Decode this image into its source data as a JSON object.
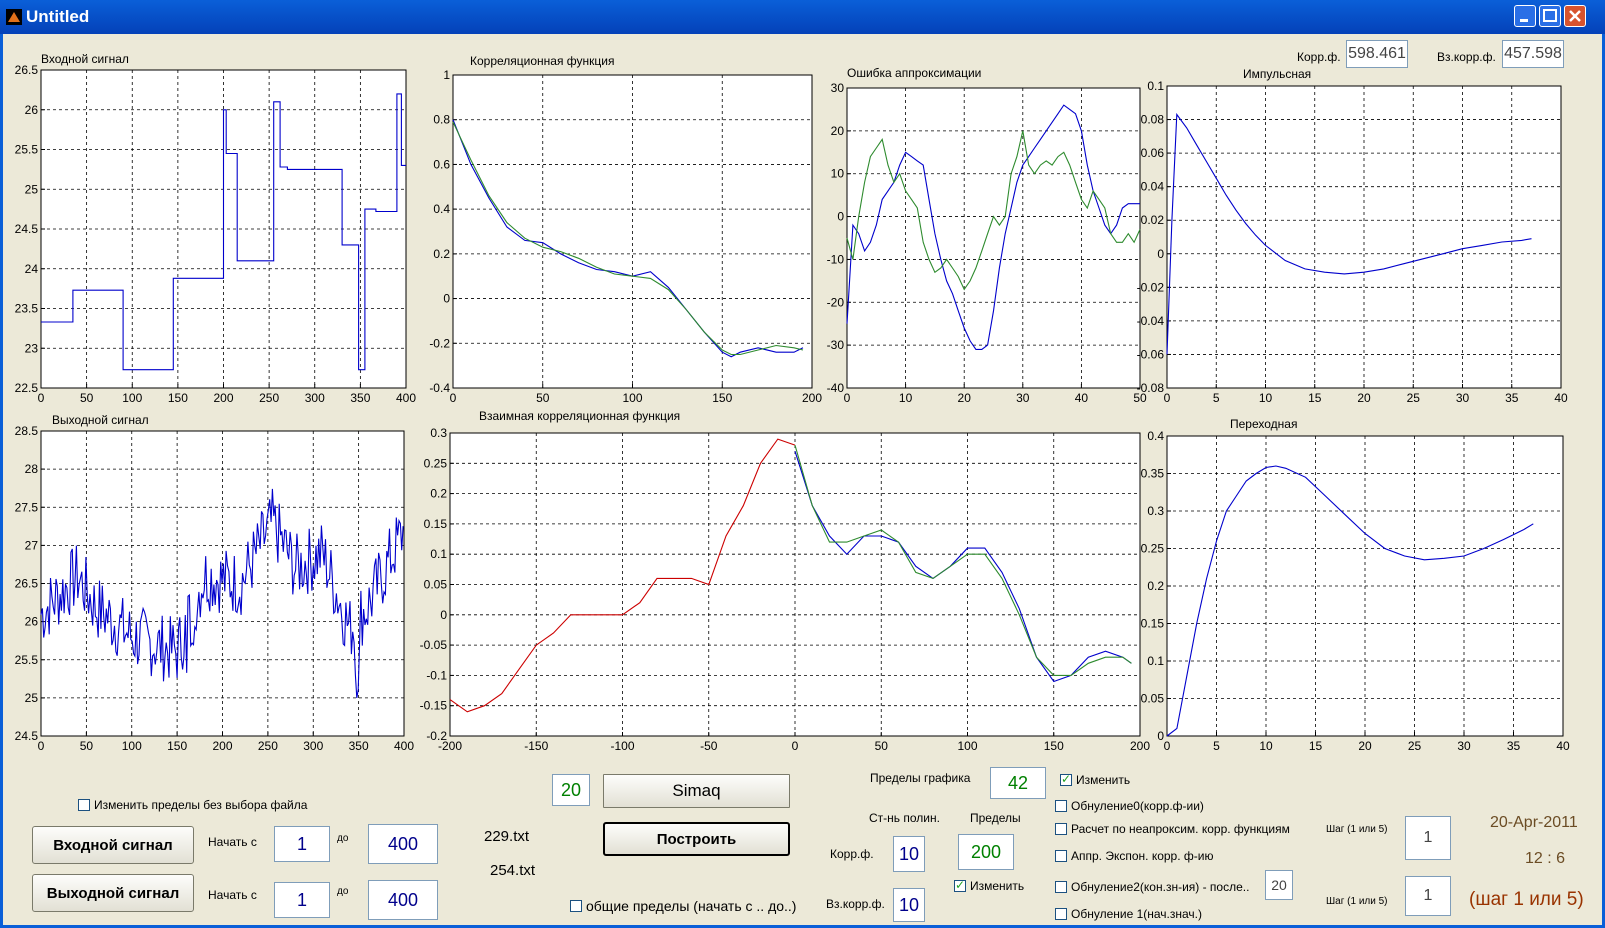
{
  "window": {
    "title": "Untitled"
  },
  "plots": [
    {
      "id": "input",
      "title": "Входной сигнал",
      "x_ticks": [
        "0",
        "50",
        "100",
        "150",
        "200",
        "250",
        "300",
        "350",
        "400"
      ],
      "y_ticks": [
        "22.5",
        "23",
        "23.5",
        "24",
        "24.5",
        "25",
        "25.5",
        "26",
        "26.5"
      ],
      "xlim": [
        0,
        400
      ],
      "ylim": [
        22.5,
        26.5
      ]
    },
    {
      "id": "corr",
      "title": "Корреляционная функция",
      "x_ticks": [
        "0",
        "50",
        "100",
        "150",
        "200"
      ],
      "y_ticks": [
        "-0.4",
        "-0.2",
        "0",
        "0.2",
        "0.4",
        "0.6",
        "0.8",
        "1"
      ],
      "xlim": [
        0,
        200
      ],
      "ylim": [
        -0.4,
        1
      ]
    },
    {
      "id": "err",
      "title": "Ошибка аппроксимации",
      "x_ticks": [
        "0",
        "10",
        "20",
        "30",
        "40",
        "50"
      ],
      "y_ticks": [
        "-40",
        "-30",
        "-20",
        "-10",
        "0",
        "10",
        "20",
        "30"
      ],
      "xlim": [
        0,
        50
      ],
      "ylim": [
        -40,
        30
      ]
    },
    {
      "id": "imp",
      "title": "Импульсная",
      "x_ticks": [
        "0",
        "5",
        "10",
        "15",
        "20",
        "25",
        "30",
        "35",
        "40"
      ],
      "y_ticks": [
        "-0.08",
        "-0.06",
        "-0.04",
        "-0.02",
        "0",
        "0.02",
        "0.04",
        "0.06",
        "0.08",
        "0.1"
      ],
      "xlim": [
        0,
        40
      ],
      "ylim": [
        -0.08,
        0.1
      ]
    },
    {
      "id": "output",
      "title": "Выходной сигнал",
      "x_ticks": [
        "0",
        "50",
        "100",
        "150",
        "200",
        "250",
        "300",
        "350",
        "400"
      ],
      "y_ticks": [
        "24.5",
        "25",
        "25.5",
        "26",
        "26.5",
        "27",
        "27.5",
        "28",
        "28.5"
      ],
      "xlim": [
        0,
        400
      ],
      "ylim": [
        24.5,
        28.5
      ]
    },
    {
      "id": "xcorr",
      "title": "Взаимная корреляционная функция",
      "x_ticks": [
        "-200",
        "-150",
        "-100",
        "-50",
        "0",
        "50",
        "100",
        "150",
        "200"
      ],
      "y_ticks": [
        "-0.2",
        "-0.15",
        "-0.1",
        "-0.05",
        "0",
        "0.05",
        "0.1",
        "0.15",
        "0.2",
        "0.25",
        "0.3"
      ],
      "xlim": [
        -200,
        200
      ],
      "ylim": [
        -0.2,
        0.3
      ]
    },
    {
      "id": "step",
      "title": "Переходная",
      "x_ticks": [
        "0",
        "5",
        "10",
        "15",
        "20",
        "25",
        "30",
        "35",
        "40"
      ],
      "y_ticks": [
        "0",
        "0.05",
        "0.1",
        "0.15",
        "0.2",
        "0.25",
        "0.3",
        "0.35",
        "0.4"
      ],
      "xlim": [
        0,
        40
      ],
      "ylim": [
        0,
        0.4
      ]
    }
  ],
  "chart_data": [
    {
      "type": "line",
      "title": "Входной сигнал",
      "xlim": [
        0,
        400
      ],
      "ylim": [
        22.5,
        26.5
      ],
      "series": [
        {
          "color": "#0000cc",
          "x": [
            0,
            35,
            35,
            90,
            90,
            145,
            145,
            200,
            200,
            203,
            203,
            215,
            215,
            255,
            255,
            262,
            262,
            270,
            270,
            330,
            330,
            348,
            348,
            355,
            355,
            367,
            367,
            390,
            390,
            395,
            395,
            400
          ],
          "y": [
            23.33,
            23.33,
            23.73,
            23.73,
            22.73,
            22.73,
            23.88,
            23.88,
            26.0,
            26.0,
            25.45,
            25.45,
            24.1,
            24.1,
            26.1,
            26.1,
            25.28,
            25.28,
            25.25,
            25.25,
            24.3,
            24.3,
            22.73,
            22.73,
            24.75,
            24.75,
            24.72,
            24.72,
            26.2,
            26.2,
            25.3,
            25.3
          ]
        }
      ]
    },
    {
      "type": "line",
      "title": "Корреляционная функция",
      "xlim": [
        0,
        200
      ],
      "ylim": [
        -0.4,
        1
      ],
      "series": [
        {
          "color": "#0000cc",
          "x": [
            0,
            10,
            20,
            30,
            40,
            50,
            60,
            70,
            80,
            90,
            100,
            110,
            120,
            130,
            140,
            150,
            155,
            160,
            170,
            180,
            190,
            195
          ],
          "y": [
            0.8,
            0.6,
            0.45,
            0.32,
            0.26,
            0.25,
            0.2,
            0.16,
            0.13,
            0.12,
            0.1,
            0.12,
            0.05,
            -0.05,
            -0.15,
            -0.24,
            -0.26,
            -0.24,
            -0.22,
            -0.24,
            -0.24,
            -0.22
          ]
        },
        {
          "color": "#2e8b2e",
          "x": [
            0,
            10,
            20,
            30,
            40,
            50,
            60,
            70,
            80,
            90,
            100,
            110,
            120,
            130,
            140,
            150,
            155,
            160,
            170,
            180,
            190,
            195
          ],
          "y": [
            0.79,
            0.62,
            0.46,
            0.34,
            0.27,
            0.23,
            0.21,
            0.18,
            0.14,
            0.11,
            0.1,
            0.09,
            0.04,
            -0.05,
            -0.15,
            -0.23,
            -0.25,
            -0.25,
            -0.23,
            -0.21,
            -0.22,
            -0.23
          ]
        }
      ]
    },
    {
      "type": "line",
      "title": "Ошибка аппроксимации",
      "xlim": [
        0,
        50
      ],
      "ylim": [
        -40,
        30
      ],
      "series": [
        {
          "color": "#0000cc",
          "x": [
            0,
            1,
            2,
            3,
            4,
            5,
            6,
            7,
            8,
            9,
            10,
            11,
            12,
            13,
            14,
            15,
            16,
            17,
            18,
            19,
            20,
            21,
            22,
            23,
            24,
            25,
            26,
            27,
            28,
            29,
            30,
            31,
            32,
            33,
            34,
            35,
            36,
            37,
            38,
            39,
            40,
            41,
            42,
            43,
            44,
            45,
            46,
            47,
            48,
            49,
            50
          ],
          "y": [
            -25,
            -2,
            -4,
            -8,
            -6,
            -2,
            4,
            6,
            8,
            12,
            15,
            14,
            13,
            12,
            4,
            -4,
            -10,
            -15,
            -18,
            -22,
            -26,
            -29,
            -31,
            -31,
            -30,
            -22,
            -12,
            -4,
            2,
            8,
            12,
            14,
            16,
            18,
            20,
            22,
            24,
            26,
            25,
            24,
            20,
            12,
            6,
            2,
            -2,
            -4,
            -2,
            2,
            3,
            3,
            3
          ]
        },
        {
          "color": "#2e8b2e",
          "x": [
            0,
            1,
            2,
            3,
            4,
            5,
            6,
            7,
            8,
            9,
            10,
            11,
            12,
            13,
            14,
            15,
            16,
            17,
            18,
            19,
            20,
            21,
            22,
            23,
            24,
            25,
            26,
            27,
            28,
            29,
            30,
            31,
            32,
            33,
            34,
            35,
            36,
            37,
            38,
            39,
            40,
            41,
            42,
            43,
            44,
            45,
            46,
            47,
            48,
            49,
            50
          ],
          "y": [
            -5,
            -10,
            0,
            8,
            14,
            16,
            18,
            12,
            8,
            10,
            6,
            4,
            2,
            -6,
            -10,
            -13,
            -12,
            -10,
            -12,
            -14,
            -17,
            -15,
            -12,
            -8,
            -4,
            0,
            -2,
            0,
            10,
            14,
            20,
            12,
            10,
            12,
            13,
            12,
            14,
            15,
            12,
            8,
            4,
            2,
            6,
            4,
            2,
            -4,
            -6,
            -6,
            -4,
            -6,
            -3
          ]
        }
      ]
    },
    {
      "type": "line",
      "title": "Импульсная",
      "xlim": [
        0,
        40
      ],
      "ylim": [
        -0.08,
        0.1
      ],
      "series": [
        {
          "color": "#0000cc",
          "x": [
            0,
            0.5,
            1,
            2,
            3,
            4,
            5,
            6,
            7,
            8,
            9,
            10,
            12,
            14,
            16,
            18,
            20,
            22,
            24,
            26,
            28,
            30,
            32,
            34,
            36,
            37
          ],
          "y": [
            -0.06,
            0.02,
            0.083,
            0.075,
            0.065,
            0.055,
            0.045,
            0.035,
            0.026,
            0.018,
            0.011,
            0.005,
            -0.004,
            -0.009,
            -0.011,
            -0.012,
            -0.011,
            -0.009,
            -0.006,
            -0.003,
            0.0,
            0.003,
            0.005,
            0.007,
            0.008,
            0.009
          ]
        }
      ]
    },
    {
      "type": "line",
      "title": "Выходной сигнал",
      "xlim": [
        0,
        400
      ],
      "ylim": [
        24.5,
        28.5
      ],
      "series": [
        {
          "color": "#0000cc",
          "note": "noisy signal",
          "x": [
            0,
            400
          ],
          "y": [
            26.0,
            27.3
          ]
        }
      ]
    },
    {
      "type": "line",
      "title": "Взаимная корреляционная функция",
      "xlim": [
        -200,
        200
      ],
      "ylim": [
        -0.2,
        0.3
      ],
      "series": [
        {
          "color": "#cc0000",
          "x": [
            -200,
            -190,
            -180,
            -170,
            -160,
            -150,
            -140,
            -130,
            -120,
            -110,
            -100,
            -90,
            -80,
            -70,
            -60,
            -50,
            -40,
            -30,
            -20,
            -10,
            0
          ],
          "y": [
            -0.14,
            -0.16,
            -0.15,
            -0.13,
            -0.09,
            -0.05,
            -0.03,
            0.0,
            0.0,
            0.0,
            0.0,
            0.02,
            0.06,
            0.06,
            0.06,
            0.05,
            0.13,
            0.18,
            0.25,
            0.29,
            0.28
          ]
        },
        {
          "color": "#0000cc",
          "x": [
            0,
            10,
            20,
            30,
            40,
            50,
            60,
            70,
            80,
            90,
            100,
            110,
            120,
            130,
            140,
            150,
            160,
            170,
            180,
            190,
            195
          ],
          "y": [
            0.27,
            0.18,
            0.13,
            0.1,
            0.13,
            0.13,
            0.12,
            0.08,
            0.06,
            0.08,
            0.11,
            0.11,
            0.07,
            0.01,
            -0.07,
            -0.11,
            -0.1,
            -0.07,
            -0.06,
            -0.07,
            -0.08
          ]
        },
        {
          "color": "#2e8b2e",
          "x": [
            0,
            10,
            20,
            30,
            40,
            50,
            60,
            70,
            80,
            90,
            100,
            110,
            120,
            130,
            140,
            150,
            160,
            170,
            180,
            190,
            195
          ],
          "y": [
            0.28,
            0.18,
            0.12,
            0.12,
            0.13,
            0.14,
            0.12,
            0.07,
            0.06,
            0.08,
            0.1,
            0.1,
            0.06,
            0.0,
            -0.07,
            -0.1,
            -0.1,
            -0.08,
            -0.07,
            -0.07,
            -0.08
          ]
        }
      ]
    },
    {
      "type": "line",
      "title": "Переходная",
      "xlim": [
        0,
        40
      ],
      "ylim": [
        0,
        0.4
      ],
      "series": [
        {
          "color": "#0000cc",
          "x": [
            0,
            1,
            2,
            3,
            4,
            5,
            6,
            7,
            8,
            9,
            10,
            11,
            12,
            14,
            16,
            18,
            20,
            22,
            24,
            26,
            28,
            30,
            32,
            34,
            36,
            37
          ],
          "y": [
            0.0,
            0.01,
            0.08,
            0.15,
            0.21,
            0.26,
            0.3,
            0.32,
            0.34,
            0.35,
            0.358,
            0.36,
            0.357,
            0.345,
            0.32,
            0.295,
            0.27,
            0.25,
            0.24,
            0.235,
            0.237,
            0.24,
            0.25,
            0.262,
            0.275,
            0.283
          ]
        }
      ]
    }
  ],
  "controls": {
    "korr_f_label": "Корр.ф.",
    "korr_f_value": "598.461",
    "vz_korr_f_label": "Вз.корр.ф.",
    "vz_korr_f_value": "457.598",
    "change_limits_no_file": "Изменить пределы без выбора файла",
    "input_signal_button": "Входной сигнал",
    "output_signal_button": "Выходной сигнал",
    "start_label": "Начать с",
    "to_label": "до",
    "input_start": "1",
    "input_end": "400",
    "output_start": "1",
    "output_end": "400",
    "file_input": "229.txt",
    "file_output": "254.txt",
    "small_value": "20",
    "simaq_button": "Simaq",
    "build_button": "Построить",
    "common_limits_label": "общие пределы (начать с .. до..)",
    "graph_limits_label": "Пределы графика",
    "graph_limits_value": "42",
    "change_label": "Изменить",
    "poly_degree_label": "Ст-нь полин.",
    "limits_label": "Пределы",
    "korr_f_poly": "10",
    "vz_korr_f_poly": "10",
    "limits_value": "200",
    "zero0_label": "Обнуление0(корр.ф-ии)",
    "calc_label": "Расчет по неапроксим. корр. функциям",
    "approx_exp_label": "Аппр. Экспон. корр. ф-ию",
    "zero2_label": "Обнуление2(кон.зн-ия) - после..",
    "zero2_value": "20",
    "zero1_label": "Обнуление 1(нач.знач.)",
    "step_label": "Шаг (1 или 5)",
    "step_value_1": "1",
    "step_value_2": "1",
    "date": "20-Apr-2011",
    "time": "12 :  6",
    "step_hint": "(шаг 1 или 5)"
  }
}
